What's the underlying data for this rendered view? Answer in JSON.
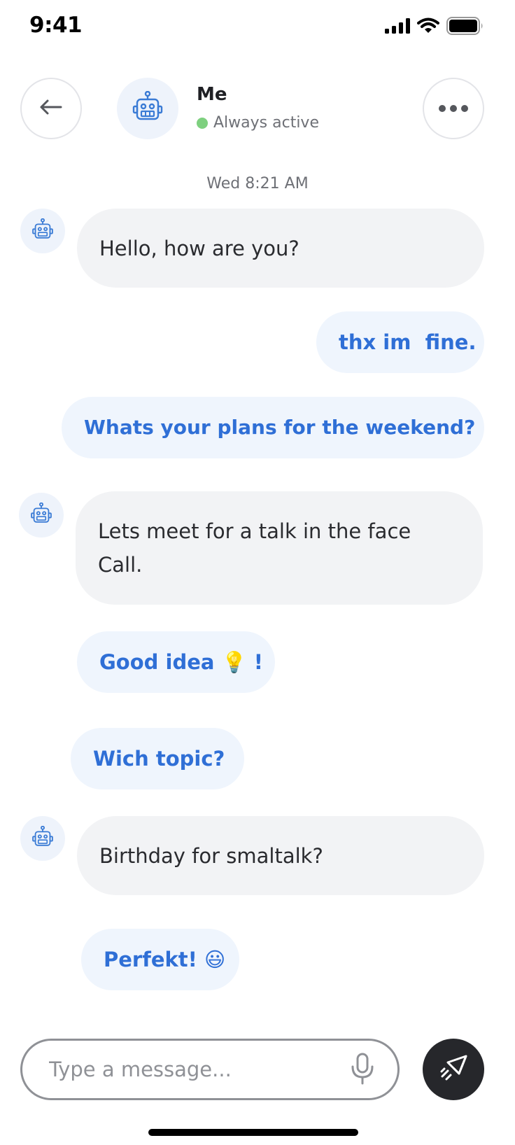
{
  "status_bar": {
    "time": "9:41"
  },
  "header": {
    "name": "Me",
    "status": "Always active",
    "icons": {
      "back": "arrow-left-icon",
      "more": "more-horizontal-icon",
      "avatar": "robot-icon"
    }
  },
  "chat": {
    "timestamp": "Wed 8:21 AM",
    "messages": [
      {
        "direction": "incoming",
        "text": "Hello, how are you?"
      },
      {
        "direction": "outgoing",
        "text": "thx im  fine."
      },
      {
        "direction": "outgoing",
        "text": "Whats your plans for the weekend?"
      },
      {
        "direction": "incoming",
        "text": "Lets meet for a talk in the face Call."
      },
      {
        "direction": "outgoing",
        "text": "Good idea 💡 !"
      },
      {
        "direction": "outgoing",
        "text": "Wich topic?"
      },
      {
        "direction": "incoming",
        "text": "Birthday for smaltalk?"
      },
      {
        "direction": "outgoing",
        "text": "Perfekt! 😃"
      }
    ]
  },
  "composer": {
    "placeholder": "Type a message...",
    "value": "",
    "icons": {
      "mic": "microphone-icon",
      "send": "send-icon"
    }
  },
  "colors": {
    "accent_text": "#2f6fd6",
    "outgoing_bubble": "#eff5fd",
    "incoming_bubble": "#f2f3f5",
    "online": "#7ed07f",
    "send_button": "#26272b"
  }
}
